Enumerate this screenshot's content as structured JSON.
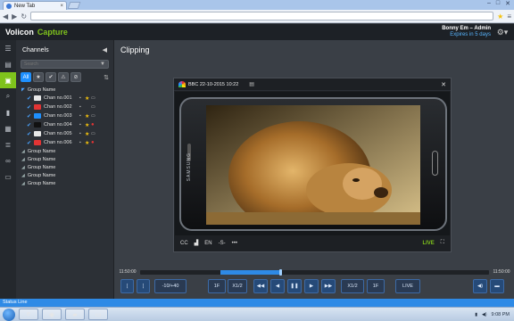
{
  "browser": {
    "tab_title": "New Tab",
    "tab_close": "×"
  },
  "app": {
    "logo": "Volicon",
    "product": "Capture",
    "user_name": "Bonny Em – Admin",
    "expiry": "Expires in 5 days"
  },
  "sidebar": {
    "title": "Channels",
    "search_placeholder": "Search",
    "filter_all_label": "All",
    "groups": [
      {
        "label": "Group Name",
        "expanded": true
      },
      {
        "label": "Group Name",
        "expanded": false
      },
      {
        "label": "Group Name",
        "expanded": false
      },
      {
        "label": "Group Name",
        "expanded": false
      },
      {
        "label": "Group Name",
        "expanded": false
      },
      {
        "label": "Group Name",
        "expanded": false
      }
    ],
    "channels": [
      {
        "name": "Chan no.001",
        "logo_color": "#e8e8e8",
        "starred": true,
        "recording": false
      },
      {
        "name": "Chan no.002",
        "logo_color": "#e23434",
        "starred": false,
        "recording": false
      },
      {
        "name": "Chan no.003",
        "logo_color": "#1e90ff",
        "starred": true,
        "recording": false
      },
      {
        "name": "Chan no.004",
        "logo_color": "#111111",
        "starred": true,
        "recording": true
      },
      {
        "name": "Chan no.005",
        "logo_color": "#e8e8e8",
        "starred": true,
        "recording": false
      },
      {
        "name": "Chan no.006",
        "logo_color": "#e23434",
        "starred": true,
        "recording": true
      }
    ]
  },
  "main": {
    "page_title": "Clipping"
  },
  "player": {
    "channel": "BBC",
    "datetime": "22-10-2015 10:22",
    "device_brand": "SAMSUNG",
    "cc_label": "CC",
    "lang_label": "EN",
    "speed_label": "-S-",
    "more_label": "•••",
    "live_label": "LIVE"
  },
  "timeline": {
    "start": "11:50:00",
    "end": "11:50:00",
    "selection_start": 0.23,
    "selection_end": 0.4,
    "playhead": 0.4
  },
  "controls": {
    "step_back": "-10/+40",
    "frame_back": "1F",
    "half_back": "X1/2",
    "half_fwd": "X1/2",
    "frame_fwd": "1F",
    "live": "LIVE"
  },
  "status": {
    "line": "Status Line"
  },
  "taskbar": {
    "clock": "9:08 PM"
  }
}
